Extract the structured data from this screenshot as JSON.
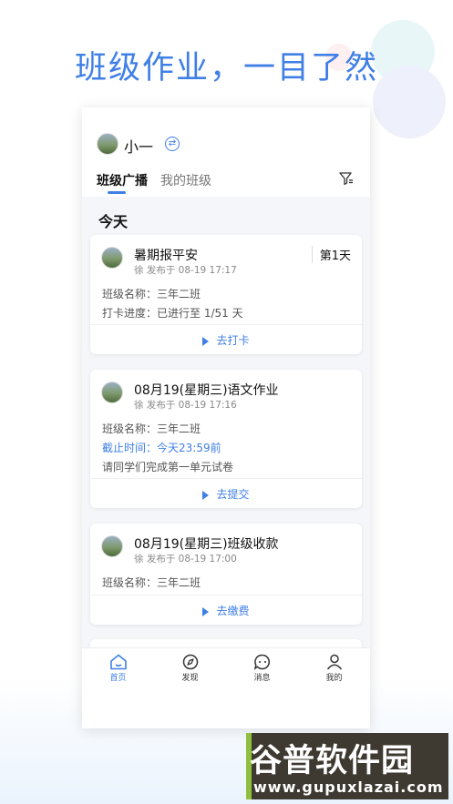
{
  "hero": {
    "title": "班级作业，一目了然"
  },
  "header": {
    "username": "小一",
    "tabs": [
      {
        "label": "班级广播",
        "active": true
      },
      {
        "label": "我的班级",
        "active": false
      }
    ]
  },
  "section": {
    "title": "今天"
  },
  "cards": [
    {
      "title": "暑期报平安",
      "meta": "徐 发布于 08-19 17:17",
      "badge": "第1天",
      "lines": [
        "班级名称：三年二班",
        "打卡进度：已进行至 1/51 天"
      ],
      "action": "去打卡"
    },
    {
      "title": "08月19(星期三)语文作业",
      "meta": "徐 发布于 08-19 17:16",
      "lines": [
        "班级名称：三年二班",
        "截止时间：今天23:59前",
        "请同学们完成第一单元试卷"
      ],
      "action": "去提交"
    },
    {
      "title": "08月19(星期三)班级收款",
      "meta": "徐 发布于 08-19 17:00",
      "lines": [
        "班级名称：三年二班"
      ],
      "action": "去缴费"
    }
  ],
  "tabbar": [
    {
      "label": "首页",
      "icon": "home-icon",
      "active": true
    },
    {
      "label": "发现",
      "icon": "compass-icon",
      "active": false
    },
    {
      "label": "消息",
      "icon": "message-icon",
      "active": false
    },
    {
      "label": "我的",
      "icon": "user-icon",
      "active": false
    }
  ],
  "watermark": {
    "title": "谷普软件园",
    "url": "www.gupuxlazai.com"
  },
  "colors": {
    "accent": "#3f7fe6",
    "background": "#f4f6f9"
  }
}
